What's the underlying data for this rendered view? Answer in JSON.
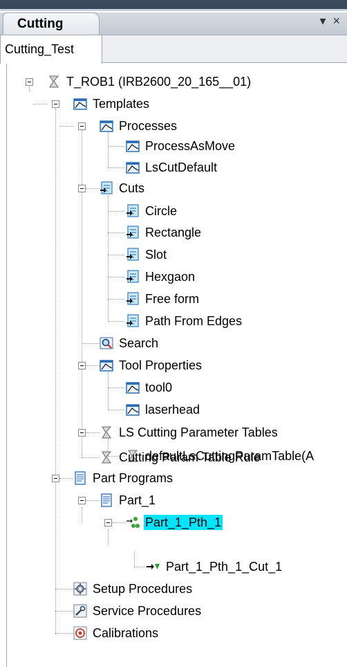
{
  "panel": {
    "title": "Cutting",
    "pin_glyph": "▾",
    "close_glyph": "×"
  },
  "document_tab": {
    "label": "Cutting_Test"
  },
  "tree": {
    "robot": "T_ROB1 (IRB2600_20_165__01)",
    "templates": "Templates",
    "processes": "Processes",
    "process_items": [
      "ProcessAsMove",
      "LsCutDefault"
    ],
    "cuts": "Cuts",
    "cut_items": [
      "Circle",
      "Rectangle",
      "Slot",
      "Hexgaon",
      "Free form",
      "Path From Edges"
    ],
    "search": "Search",
    "tool_properties": "Tool Properties",
    "tool_items": [
      "tool0",
      "laserhead"
    ],
    "ls_param_tables": "LS Cutting Parameter Tables",
    "ls_param_table_item": "defaultLsCuttingParamTable(A",
    "cutting_param_rule": "Cutting Param Table Rule",
    "part_programs": "Part Programs",
    "part_1": "Part_1",
    "part_1_path": "Part_1_Pth_1",
    "part_1_cut": "Part_1_Pth_1_Cut_1",
    "setup_procedures": "Setup Procedures",
    "service_procedures": "Service Procedures",
    "calibrations": "Calibrations"
  },
  "colors": {
    "selection": "#00e5ff",
    "frame": "#3a4a5c"
  }
}
